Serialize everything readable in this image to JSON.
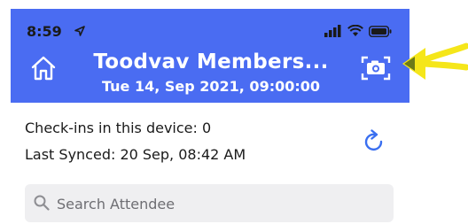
{
  "status_bar": {
    "time": "8:59"
  },
  "header": {
    "title": "Toodvav Members...",
    "subtitle": "Tue 14, Sep 2021, 09:00:00",
    "color": "#4a6cf2"
  },
  "info": {
    "checkins": "Check-ins in this device: 0",
    "last_synced": "Last Synced: 20 Sep, 08:42 AM"
  },
  "search": {
    "placeholder": "Search Attendee"
  },
  "icons": {
    "home": "home-icon",
    "camera": "camera-icon",
    "refresh": "refresh-icon",
    "search": "search-icon",
    "location": "location-arrow-icon",
    "annotation": "annotation-arrow-icon"
  },
  "colors": {
    "accent": "#4a6cf2",
    "annotation": "#f5e61a"
  }
}
